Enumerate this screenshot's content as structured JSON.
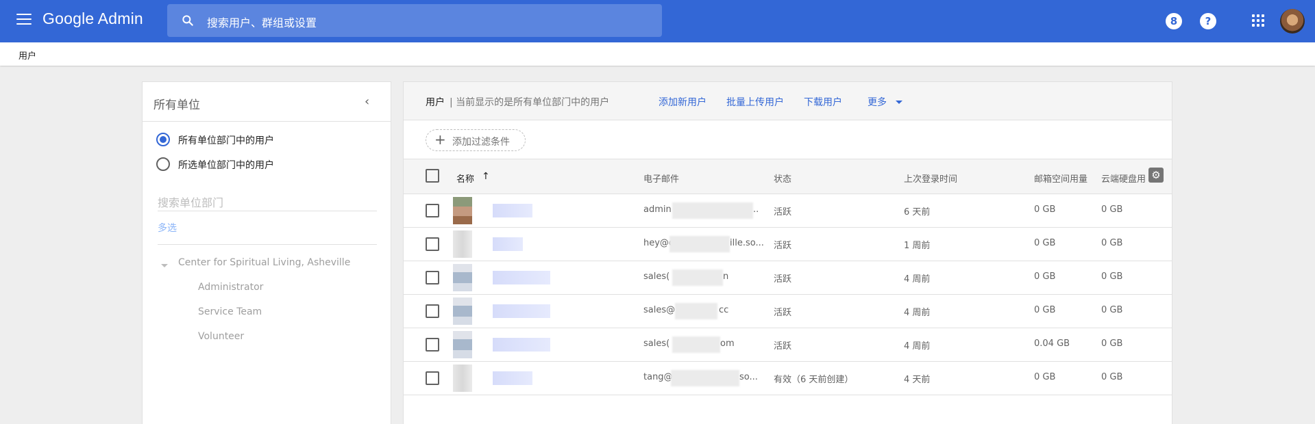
{
  "topbar": {
    "brand": "Google Admin",
    "search_placeholder": "搜索用户、群组或设置",
    "support_icon_text": "8",
    "help_icon_text": "?"
  },
  "breadcrumb": {
    "label": "用户"
  },
  "left_panel": {
    "title": "所有单位",
    "options": [
      {
        "label": "所有单位部门中的用户",
        "selected": true
      },
      {
        "label": "所选单位部门中的用户",
        "selected": false
      }
    ],
    "search_placeholder": "搜索单位部门",
    "multi_select": "多选",
    "tree": {
      "root": "Center for Spiritual Living, Asheville",
      "children": [
        "Administrator",
        "Service Team",
        "Volunteer"
      ]
    }
  },
  "main": {
    "title": "用户",
    "subtitle": "| 当前显示的是所有单位部门中的用户",
    "actions": {
      "add": "添加新用户",
      "bulk": "批量上传用户",
      "download": "下载用户",
      "more": "更多"
    },
    "filter_label": "添加过滤条件",
    "columns": {
      "name": "名称",
      "email": "电子邮件",
      "status": "状态",
      "last_login": "上次登录时间",
      "mail_storage": "邮箱空间用量",
      "drive_storage": "云端硬盘用"
    },
    "rows": [
      {
        "email": "admin",
        "email_tail": "..",
        "status": "活跃",
        "last_login": "6 天前",
        "mail": "0 GB",
        "drive": "0 GB"
      },
      {
        "email": "hey@c",
        "email_tail": "ille.so...",
        "status": "活跃",
        "last_login": "1 周前",
        "mail": "0 GB",
        "drive": "0 GB"
      },
      {
        "email": "sales(",
        "email_tail": "n",
        "status": "活跃",
        "last_login": "4 周前",
        "mail": "0 GB",
        "drive": "0 GB"
      },
      {
        "email": "sales@",
        "email_tail": "cc",
        "status": "活跃",
        "last_login": "4 周前",
        "mail": "0 GB",
        "drive": "0 GB"
      },
      {
        "email": "sales(",
        "email_tail": "om",
        "status": "活跃",
        "last_login": "4 周前",
        "mail": "0.04 GB",
        "drive": "0 GB"
      },
      {
        "email": "tang@",
        "email_tail": "so...",
        "status": "有效（6 天前创建）",
        "last_login": "4 天前",
        "mail": "0 GB",
        "drive": "0 GB"
      }
    ]
  }
}
